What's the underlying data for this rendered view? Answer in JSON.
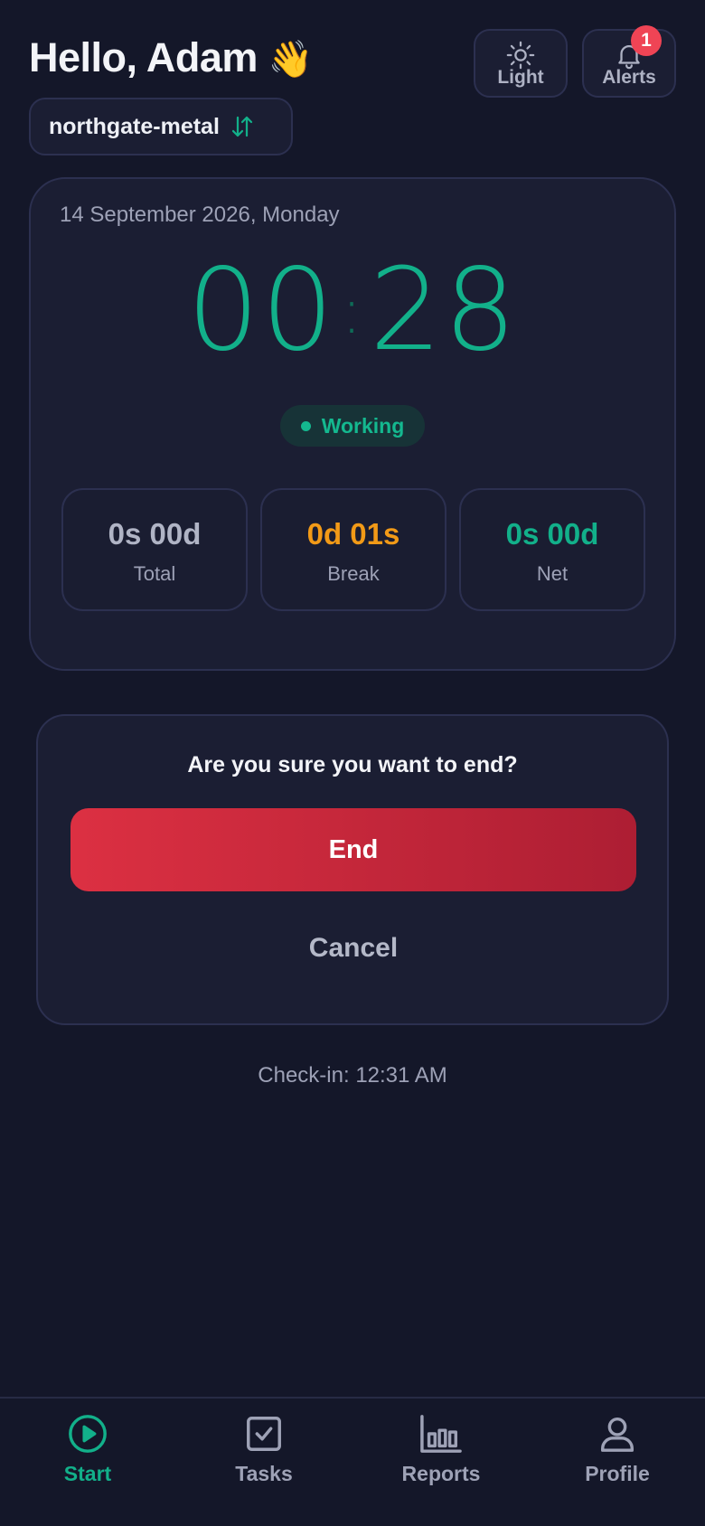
{
  "header": {
    "greeting": "Hello, Adam",
    "wave_emoji": "👋",
    "light_label": "Light",
    "alerts_label": "Alerts",
    "alerts_count": "1"
  },
  "workspace": {
    "name": "northgate-metal",
    "switch_icon": "swap-vertical-icon"
  },
  "timer": {
    "date": "14 September 2026, Monday",
    "minutes": "00",
    "separator": ":",
    "seconds": "28",
    "status": "Working",
    "stats": [
      {
        "value": "0s 00d",
        "label": "Total",
        "color": "#b0b4c5"
      },
      {
        "value": "0d 01s",
        "label": "Break",
        "color": "#f29a17"
      },
      {
        "value": "0s 00d",
        "label": "Net",
        "color": "#12b08a"
      }
    ]
  },
  "confirm": {
    "question": "Are you sure you want to end?",
    "end_label": "End",
    "cancel_label": "Cancel"
  },
  "checkin": "Check-in: 12:31 AM",
  "tabs": [
    {
      "label": "Start",
      "icon": "play-circle-icon",
      "active": true
    },
    {
      "label": "Tasks",
      "icon": "checkbox-icon",
      "active": false
    },
    {
      "label": "Reports",
      "icon": "bar-chart-icon",
      "active": false
    },
    {
      "label": "Profile",
      "icon": "user-icon",
      "active": false
    }
  ],
  "colors": {
    "background": "#141729",
    "accent_green": "#12b08a",
    "break_orange": "#f29a17",
    "danger_red": "#dc3042",
    "badge_red": "#ef4455"
  }
}
